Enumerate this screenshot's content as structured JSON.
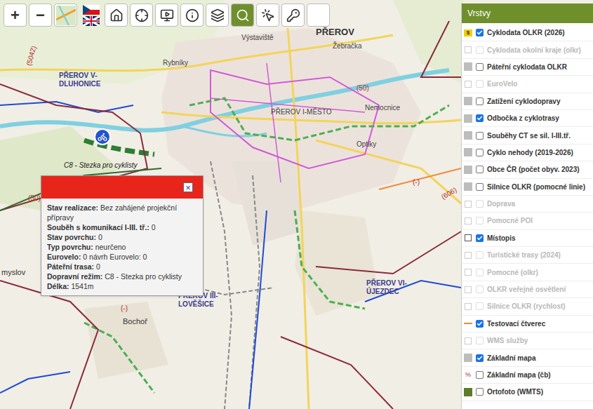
{
  "toolbar": {
    "text_buttons": [
      {
        "label": "+"
      },
      {
        "label": "−"
      }
    ],
    "icon_buttons": [
      {
        "selected": false
      },
      {
        "selected": false
      },
      {
        "selected": false
      },
      {
        "selected": false
      },
      {
        "selected": false
      },
      {
        "selected": false
      },
      {
        "selected": false
      },
      {
        "selected": true
      },
      {
        "selected": false
      },
      {
        "selected": false
      },
      {
        "selected": false
      }
    ]
  },
  "layers_panel": {
    "title": "Vrstvy",
    "items": [
      {
        "label": "Cyklodata OLKR (2026)",
        "checked": true,
        "disabled": false,
        "kind": "badge",
        "badge": "$"
      },
      {
        "label": "Cyklodata okolní kraje (olkr)",
        "checked": false,
        "disabled": true,
        "kind": "group"
      },
      {
        "label": "Páteřní cyklodata OLKR",
        "checked": false,
        "disabled": false,
        "kind": "box"
      },
      {
        "label": "EuroVelo",
        "checked": false,
        "disabled": true,
        "kind": "group"
      },
      {
        "label": "Zatížení cyklodopravy",
        "checked": false,
        "disabled": false,
        "kind": "box"
      },
      {
        "label": "Odbočka z cyklotrasy",
        "checked": true,
        "disabled": false,
        "kind": "box"
      },
      {
        "label": "Souběhy CT se sil. I-III.tř.",
        "checked": false,
        "disabled": false,
        "kind": "box"
      },
      {
        "label": "Cyklo nehody (2019-2026)",
        "checked": false,
        "disabled": false,
        "kind": "box"
      },
      {
        "label": "Obce ČR (počet obyv. 2023)",
        "checked": false,
        "disabled": false,
        "kind": "box"
      },
      {
        "label": "Silnice OLKR (pomocné linie)",
        "checked": false,
        "disabled": false,
        "kind": "box"
      },
      {
        "label": "Doprava",
        "checked": false,
        "disabled": true,
        "kind": "group"
      },
      {
        "label": "Pomocné POI",
        "checked": false,
        "disabled": true,
        "kind": "group"
      },
      {
        "label": "Místopis",
        "checked": true,
        "disabled": false,
        "kind": "group"
      },
      {
        "label": "Turistické trasy (2024)",
        "checked": false,
        "disabled": true,
        "kind": "group"
      },
      {
        "label": "Pomocné (olkr)",
        "checked": false,
        "disabled": true,
        "kind": "group"
      },
      {
        "label": "OLKR veřejné osvětlení",
        "checked": false,
        "disabled": true,
        "kind": "group"
      },
      {
        "label": "Silnice OLKR (rychlost)",
        "checked": false,
        "disabled": true,
        "kind": "group"
      },
      {
        "label": "Testovací čtverec",
        "checked": true,
        "disabled": false,
        "kind": "line"
      },
      {
        "label": "WMS služby",
        "checked": false,
        "disabled": true,
        "kind": "group"
      },
      {
        "label": "Základní mapa",
        "checked": true,
        "disabled": false,
        "kind": "box"
      },
      {
        "label": "Základní mapa (čb)",
        "checked": false,
        "disabled": false,
        "kind": "hatch",
        "badge": "%"
      },
      {
        "label": "Ortofoto (WMTS)",
        "checked": false,
        "disabled": false,
        "kind": "green"
      }
    ]
  },
  "popup": {
    "close": "×",
    "rows": [
      {
        "label": "Stav realizace:",
        "value": "Bez zahájené projekční přípravy"
      },
      {
        "label": "Souběh s komunikací I-III. tř.:",
        "value": "0"
      },
      {
        "label": "Stav povrchu:",
        "value": "0"
      },
      {
        "label": "Typ povrchu:",
        "value": "neurčeno"
      },
      {
        "label": "Eurovelo:",
        "value": "0 návrh Eurovelo: 0"
      },
      {
        "label": "Páteřní trasa:",
        "value": "0"
      },
      {
        "label": "Dopravní režim:",
        "value": "C8 - Stezka pro cyklisty"
      },
      {
        "label": "Délka:",
        "value": "1541m"
      }
    ]
  },
  "map_labels": [
    {
      "text": "PŘEROV",
      "kind": "town"
    },
    {
      "text": "Žebračka",
      "kind": "place"
    },
    {
      "text": "Výstaviště",
      "kind": "place"
    },
    {
      "text": "PŘEROV V-DLUHONICE",
      "kind": "district"
    },
    {
      "text": "Rybníky",
      "kind": "place"
    },
    {
      "text": "PŘEROV I-MĚSTO",
      "kind": "place"
    },
    {
      "text": "Nemocnice",
      "kind": "place"
    },
    {
      "text": "Optiky",
      "kind": "place"
    },
    {
      "text": "C8 - Stezka pro cyklisty",
      "kind": "route"
    },
    {
      "text": "PŘEROV III-LOVĚŠICE",
      "kind": "district"
    },
    {
      "text": "PŘEROV VI-ÚJEZDEC",
      "kind": "district"
    },
    {
      "text": "Bochoř",
      "kind": "village"
    },
    {
      "text": "myslov",
      "kind": "village"
    },
    {
      "text": "(5042)",
      "kind": "road"
    },
    {
      "text": "(50)",
      "kind": "road"
    },
    {
      "text": "(50)",
      "kind": "road"
    },
    {
      "text": "(606)",
      "kind": "road"
    },
    {
      "text": "(-)",
      "kind": "road"
    },
    {
      "text": "(-)",
      "kind": "road"
    }
  ]
}
